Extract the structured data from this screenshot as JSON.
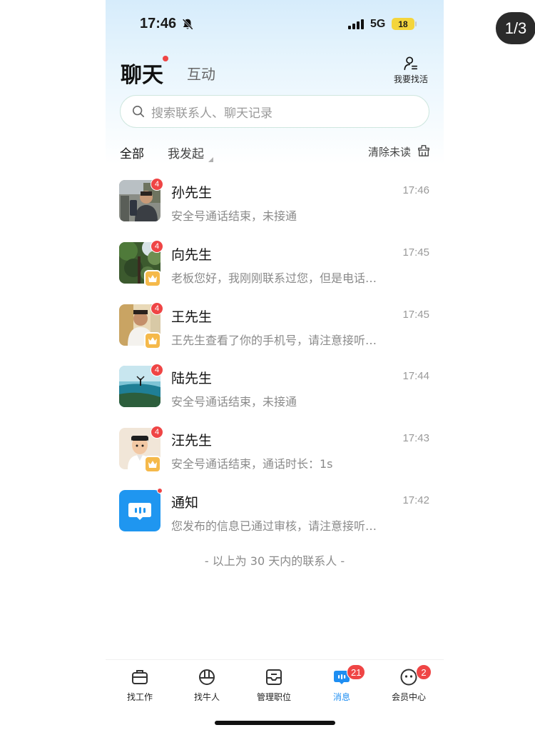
{
  "viewer": {
    "page_indicator": "1/3"
  },
  "status_bar": {
    "time": "17:46",
    "network": "5G",
    "battery": "18"
  },
  "header": {
    "title": "聊天",
    "tab_interact": "互动",
    "find_job_label": "我要找活"
  },
  "search": {
    "placeholder": "搜索联系人、聊天记录"
  },
  "filters": {
    "all": "全部",
    "initiated": "我发起",
    "clear_unread": "清除未读"
  },
  "conversations": [
    {
      "name": "孙先生",
      "time": "17:46",
      "preview": "安全号通话结束，未接通",
      "unread": "4",
      "vip": false
    },
    {
      "name": "向先生",
      "time": "17:45",
      "preview": "老板您好，我刚刚联系过您，但是电话…",
      "unread": "4",
      "vip": true
    },
    {
      "name": "王先生",
      "time": "17:45",
      "preview": "王先生查看了你的手机号，请注意接听…",
      "unread": "4",
      "vip": true
    },
    {
      "name": "陆先生",
      "time": "17:44",
      "preview": "安全号通话结束，未接通",
      "unread": "4",
      "vip": false
    },
    {
      "name": "汪先生",
      "time": "17:43",
      "preview": "安全号通话结束，通话时长：1s",
      "unread": "4",
      "vip": true
    },
    {
      "name": "通知",
      "time": "17:42",
      "preview": "您发布的信息已通过审核，请注意接听…",
      "unread": "",
      "vip": false
    }
  ],
  "footer_note": "- 以上为 30 天内的联系人 -",
  "bottom_nav": [
    {
      "label": "找工作",
      "icon": "briefcase-icon",
      "badge": ""
    },
    {
      "label": "找牛人",
      "icon": "hardhat-icon",
      "badge": ""
    },
    {
      "label": "管理职位",
      "icon": "inbox-icon",
      "badge": ""
    },
    {
      "label": "消息",
      "icon": "message-icon",
      "badge": "21",
      "active": true
    },
    {
      "label": "会员中心",
      "icon": "smiley-icon",
      "badge": "2"
    }
  ],
  "colors": {
    "accent": "#1e8ef2",
    "badge": "#ef4545",
    "vip": "#f5b94a"
  }
}
